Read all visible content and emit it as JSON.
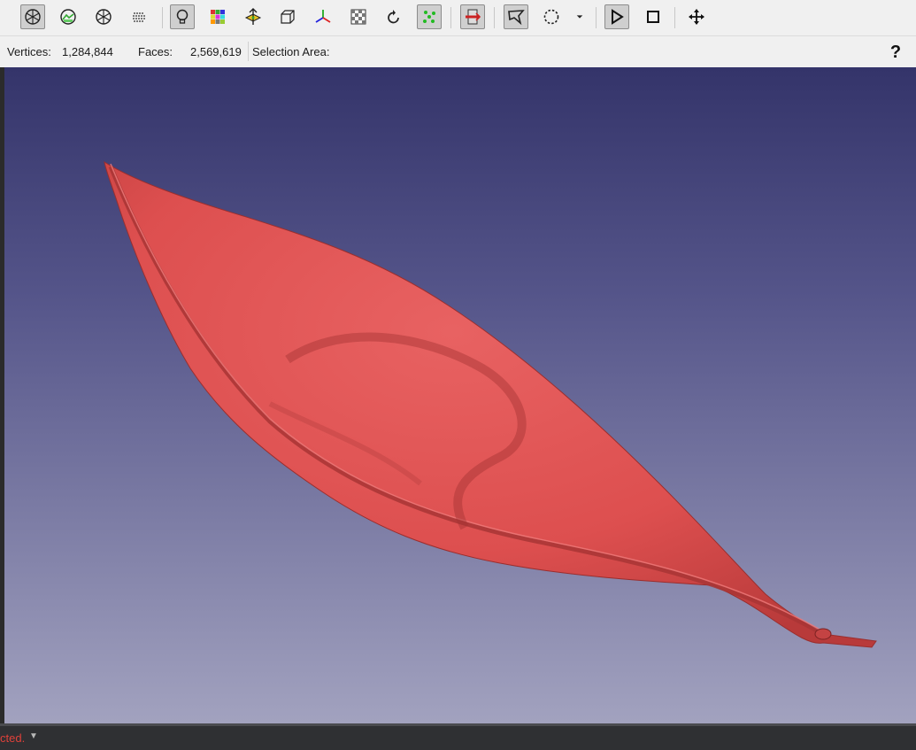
{
  "toolbar": {
    "buttons": [
      {
        "icon": "points-render-icon"
      },
      {
        "icon": "wireframe-render-icon"
      },
      {
        "icon": "flat-render-icon"
      },
      {
        "icon": "dots-render-icon"
      },
      {
        "icon": "light-bulb-icon"
      },
      {
        "icon": "color-grid-icon"
      },
      {
        "icon": "layers-icon"
      },
      {
        "icon": "bounding-box-icon"
      },
      {
        "icon": "axis-icon"
      },
      {
        "icon": "texture-icon"
      },
      {
        "icon": "rotate-icon"
      },
      {
        "icon": "select-vertices-icon"
      },
      {
        "icon": "select-faces-icon"
      },
      {
        "icon": "lasso-select-icon"
      },
      {
        "icon": "circle-select-icon"
      },
      {
        "icon": "dropdown-arrow-icon"
      },
      {
        "icon": "play-icon"
      },
      {
        "icon": "stop-icon"
      },
      {
        "icon": "move-icon"
      }
    ]
  },
  "info": {
    "vertices_label": "Vertices:",
    "vertices_value": "1,284,844",
    "faces_label": "Faces:",
    "faces_value": "2,569,619",
    "selection_label": "Selection Area:",
    "help_label": "?"
  },
  "status": {
    "text": "cted.",
    "arrow": "▼"
  },
  "colors": {
    "mesh": "#e05050",
    "background_top": "#34346a",
    "background_bottom": "#a2a2bf",
    "status_text": "#e0413a"
  }
}
